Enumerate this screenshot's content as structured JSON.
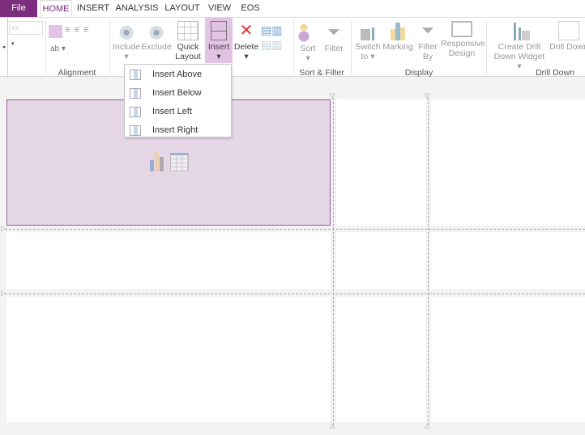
{
  "tabs": [
    "File",
    "HOME",
    "INSERT",
    "ANALYSIS",
    "LAYOUT",
    "VIEW",
    "EOS"
  ],
  "ribbon": {
    "font_size_placeholder": "xx",
    "groups": {
      "alignment": "Alignment",
      "sort_filter": "Sort & Filter",
      "display": "Display",
      "drill_down": "Drill Down"
    },
    "buttons": {
      "include": "Include",
      "exclude": "Exclude",
      "quick_layout_1": "Quick",
      "quick_layout_2": "Layout",
      "insert": "Insert",
      "delete": "Delete",
      "sort": "Sort",
      "filter": "Filter",
      "switch_to_1": "Switch",
      "switch_to_2": "to",
      "marking": "Marking",
      "filter_by_1": "Filter",
      "filter_by_2": "By",
      "responsive_1": "Responsive",
      "responsive_2": "Design",
      "create_drill_1": "Create Drill",
      "create_drill_2": "Down Widget",
      "drill_down": "Drill Down"
    }
  },
  "insert_menu": [
    "Insert Above",
    "Insert Below",
    "Insert Left",
    "Insert Right"
  ],
  "colors": {
    "accent": "#7b2d7e",
    "selected_bg": "#e5d7e6",
    "insert_highlight": "#e3c3e3"
  }
}
